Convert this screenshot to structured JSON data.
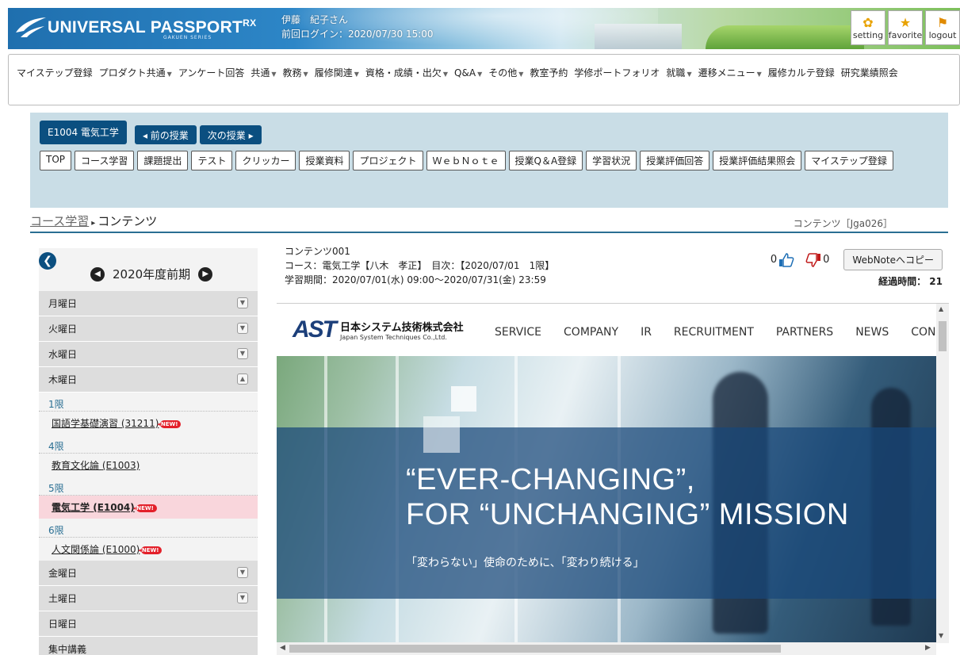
{
  "header": {
    "brand": "UNIVERSAL PASSPORT",
    "brand_sup": "RX",
    "brand_sub": "GAKUEN SERIES",
    "user_name": "伊藤　紀子さん",
    "last_login": "前回ログイン：2020/07/30 15:00",
    "buttons": [
      {
        "label": "setting",
        "icon": "gear-icon"
      },
      {
        "label": "favorite",
        "icon": "star-icon"
      },
      {
        "label": "logout",
        "icon": "runner-icon"
      }
    ]
  },
  "menu": {
    "items": [
      {
        "label": "マイステップ登録",
        "dropdown": false
      },
      {
        "label": "プロダクト共通",
        "dropdown": true
      },
      {
        "label": "アンケート回答",
        "dropdown": false
      },
      {
        "label": "共通",
        "dropdown": true
      },
      {
        "label": "教務",
        "dropdown": true
      },
      {
        "label": "履修関連",
        "dropdown": true
      },
      {
        "label": "資格・成績・出欠",
        "dropdown": true
      },
      {
        "label": "Q&A",
        "dropdown": true
      },
      {
        "label": "その他",
        "dropdown": true
      },
      {
        "label": "教室予約",
        "dropdown": false
      },
      {
        "label": "学修ポートフォリオ",
        "dropdown": false
      },
      {
        "label": "就職",
        "dropdown": true
      },
      {
        "label": "遷移メニュー",
        "dropdown": true
      },
      {
        "label": "履修カルテ登録",
        "dropdown": false
      },
      {
        "label": "研究業績照会",
        "dropdown": false
      }
    ]
  },
  "course": {
    "code_label": "E1004 電気工学",
    "prev_label": "◂ 前の授業",
    "next_label": "次の授業 ▸",
    "tabs": [
      "TOP",
      "コース学習",
      "課題提出",
      "テスト",
      "クリッカー",
      "授業資料",
      "プロジェクト",
      "ＷｅｂＮｏｔｅ",
      "授業Q＆A登録",
      "学習状況",
      "授業評価回答",
      "授業評価結果照会",
      "マイステップ登録"
    ]
  },
  "breadcrumb": {
    "link": "コース学習",
    "current": "コンテンツ",
    "screen_code": "コンテンツ［Jga026］"
  },
  "sidebar": {
    "term": "2020年度前期",
    "days": [
      {
        "label": "月曜日",
        "state": "collapsed"
      },
      {
        "label": "火曜日",
        "state": "collapsed"
      },
      {
        "label": "水曜日",
        "state": "collapsed"
      },
      {
        "label": "木曜日",
        "state": "expanded"
      }
    ],
    "thursday": [
      {
        "period": "1限",
        "lecture": "国語学基礎演習",
        "code": "(31211)",
        "new": true,
        "active": false
      },
      {
        "period": "4限",
        "lecture": "教育文化論",
        "code": "(E1003)",
        "new": false,
        "active": false
      },
      {
        "period": "5限",
        "lecture": "電気工学",
        "code": "(E1004)",
        "new": true,
        "active": true
      },
      {
        "period": "6限",
        "lecture": "人文関係論",
        "code": "(E1000)",
        "new": true,
        "active": false
      }
    ],
    "days_after": [
      {
        "label": "金曜日",
        "state": "collapsed"
      },
      {
        "label": "土曜日",
        "state": "collapsed"
      },
      {
        "label": "日曜日",
        "state": "none"
      },
      {
        "label": "集中講義",
        "state": "none"
      }
    ],
    "new_badge": "NEW!"
  },
  "content": {
    "title": "コンテンツ001",
    "course_line": "コース：電気工学【八木　孝正】　目次：【2020/07/01　1限】",
    "period_line": "学習期間：2020/07/01(水) 09:00～2020/07/31(金) 23:59",
    "likes": "0",
    "dislikes": "0",
    "copy_label": "WebNoteへコピー",
    "elapsed": "経過時間： 21"
  },
  "embedded": {
    "logo_mark": "AST",
    "company_jp": "日本システム技術株式会社",
    "company_en": "Japan System Techniques Co.,Ltd.",
    "nav": [
      "SERVICE",
      "COMPANY",
      "IR",
      "RECRUITMENT",
      "PARTNERS",
      "NEWS",
      "CON"
    ],
    "headline1": "“EVER-CHANGING”,",
    "headline2": "FOR “UNCHANGING” MISSION",
    "tagline": "「変わらない」使命のために、「変わり続ける」"
  }
}
